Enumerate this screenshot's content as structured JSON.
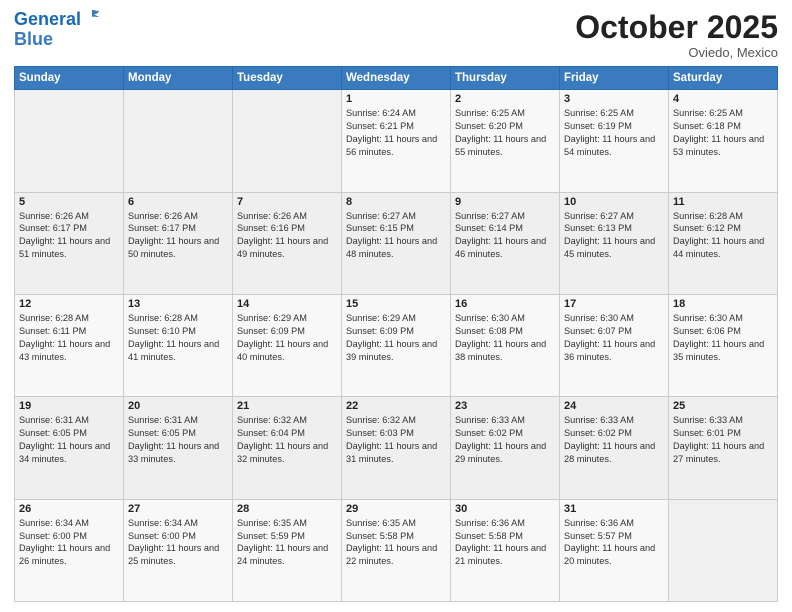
{
  "header": {
    "logo_line1": "General",
    "logo_line2": "Blue",
    "month": "October 2025",
    "location": "Oviedo, Mexico"
  },
  "weekdays": [
    "Sunday",
    "Monday",
    "Tuesday",
    "Wednesday",
    "Thursday",
    "Friday",
    "Saturday"
  ],
  "weeks": [
    [
      {
        "day": "",
        "info": ""
      },
      {
        "day": "",
        "info": ""
      },
      {
        "day": "",
        "info": ""
      },
      {
        "day": "1",
        "info": "Sunrise: 6:24 AM\nSunset: 6:21 PM\nDaylight: 11 hours and 56 minutes."
      },
      {
        "day": "2",
        "info": "Sunrise: 6:25 AM\nSunset: 6:20 PM\nDaylight: 11 hours and 55 minutes."
      },
      {
        "day": "3",
        "info": "Sunrise: 6:25 AM\nSunset: 6:19 PM\nDaylight: 11 hours and 54 minutes."
      },
      {
        "day": "4",
        "info": "Sunrise: 6:25 AM\nSunset: 6:18 PM\nDaylight: 11 hours and 53 minutes."
      }
    ],
    [
      {
        "day": "5",
        "info": "Sunrise: 6:26 AM\nSunset: 6:17 PM\nDaylight: 11 hours and 51 minutes."
      },
      {
        "day": "6",
        "info": "Sunrise: 6:26 AM\nSunset: 6:17 PM\nDaylight: 11 hours and 50 minutes."
      },
      {
        "day": "7",
        "info": "Sunrise: 6:26 AM\nSunset: 6:16 PM\nDaylight: 11 hours and 49 minutes."
      },
      {
        "day": "8",
        "info": "Sunrise: 6:27 AM\nSunset: 6:15 PM\nDaylight: 11 hours and 48 minutes."
      },
      {
        "day": "9",
        "info": "Sunrise: 6:27 AM\nSunset: 6:14 PM\nDaylight: 11 hours and 46 minutes."
      },
      {
        "day": "10",
        "info": "Sunrise: 6:27 AM\nSunset: 6:13 PM\nDaylight: 11 hours and 45 minutes."
      },
      {
        "day": "11",
        "info": "Sunrise: 6:28 AM\nSunset: 6:12 PM\nDaylight: 11 hours and 44 minutes."
      }
    ],
    [
      {
        "day": "12",
        "info": "Sunrise: 6:28 AM\nSunset: 6:11 PM\nDaylight: 11 hours and 43 minutes."
      },
      {
        "day": "13",
        "info": "Sunrise: 6:28 AM\nSunset: 6:10 PM\nDaylight: 11 hours and 41 minutes."
      },
      {
        "day": "14",
        "info": "Sunrise: 6:29 AM\nSunset: 6:09 PM\nDaylight: 11 hours and 40 minutes."
      },
      {
        "day": "15",
        "info": "Sunrise: 6:29 AM\nSunset: 6:09 PM\nDaylight: 11 hours and 39 minutes."
      },
      {
        "day": "16",
        "info": "Sunrise: 6:30 AM\nSunset: 6:08 PM\nDaylight: 11 hours and 38 minutes."
      },
      {
        "day": "17",
        "info": "Sunrise: 6:30 AM\nSunset: 6:07 PM\nDaylight: 11 hours and 36 minutes."
      },
      {
        "day": "18",
        "info": "Sunrise: 6:30 AM\nSunset: 6:06 PM\nDaylight: 11 hours and 35 minutes."
      }
    ],
    [
      {
        "day": "19",
        "info": "Sunrise: 6:31 AM\nSunset: 6:05 PM\nDaylight: 11 hours and 34 minutes."
      },
      {
        "day": "20",
        "info": "Sunrise: 6:31 AM\nSunset: 6:05 PM\nDaylight: 11 hours and 33 minutes."
      },
      {
        "day": "21",
        "info": "Sunrise: 6:32 AM\nSunset: 6:04 PM\nDaylight: 11 hours and 32 minutes."
      },
      {
        "day": "22",
        "info": "Sunrise: 6:32 AM\nSunset: 6:03 PM\nDaylight: 11 hours and 31 minutes."
      },
      {
        "day": "23",
        "info": "Sunrise: 6:33 AM\nSunset: 6:02 PM\nDaylight: 11 hours and 29 minutes."
      },
      {
        "day": "24",
        "info": "Sunrise: 6:33 AM\nSunset: 6:02 PM\nDaylight: 11 hours and 28 minutes."
      },
      {
        "day": "25",
        "info": "Sunrise: 6:33 AM\nSunset: 6:01 PM\nDaylight: 11 hours and 27 minutes."
      }
    ],
    [
      {
        "day": "26",
        "info": "Sunrise: 6:34 AM\nSunset: 6:00 PM\nDaylight: 11 hours and 26 minutes."
      },
      {
        "day": "27",
        "info": "Sunrise: 6:34 AM\nSunset: 6:00 PM\nDaylight: 11 hours and 25 minutes."
      },
      {
        "day": "28",
        "info": "Sunrise: 6:35 AM\nSunset: 5:59 PM\nDaylight: 11 hours and 24 minutes."
      },
      {
        "day": "29",
        "info": "Sunrise: 6:35 AM\nSunset: 5:58 PM\nDaylight: 11 hours and 22 minutes."
      },
      {
        "day": "30",
        "info": "Sunrise: 6:36 AM\nSunset: 5:58 PM\nDaylight: 11 hours and 21 minutes."
      },
      {
        "day": "31",
        "info": "Sunrise: 6:36 AM\nSunset: 5:57 PM\nDaylight: 11 hours and 20 minutes."
      },
      {
        "day": "",
        "info": ""
      }
    ]
  ]
}
